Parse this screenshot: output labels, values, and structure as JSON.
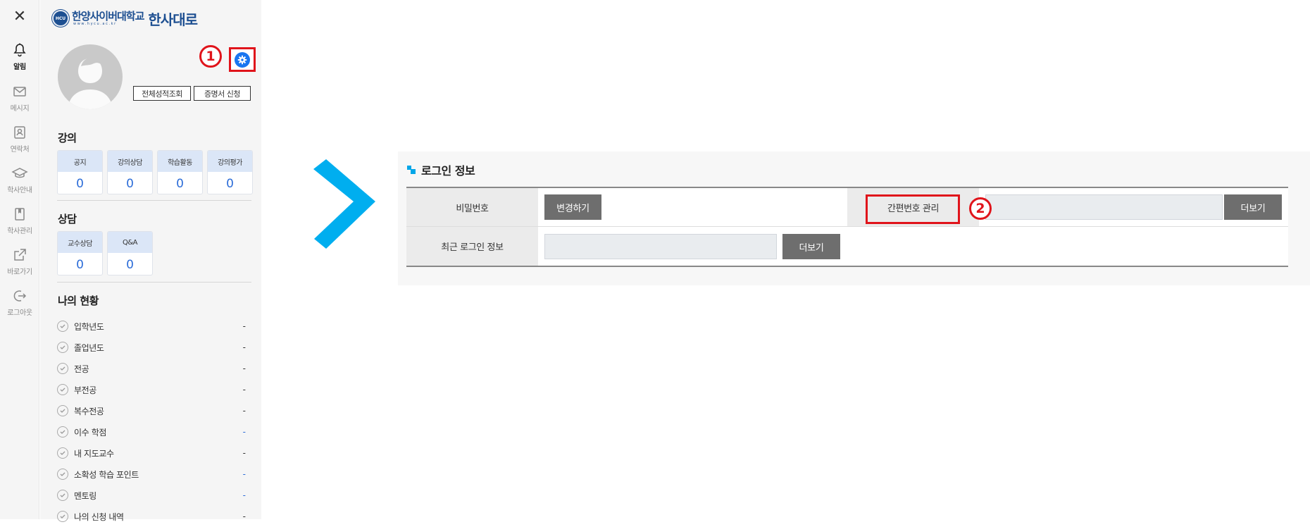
{
  "rail": {
    "close_icon": "close-icon",
    "items": [
      {
        "label": "알림",
        "icon": "bell-icon",
        "active": true
      },
      {
        "label": "메시지",
        "icon": "mail-icon"
      },
      {
        "label": "연락처",
        "icon": "contacts-icon"
      },
      {
        "label": "학사안내",
        "icon": "graduation-cap-icon"
      },
      {
        "label": "학사관리",
        "icon": "bookmark-icon"
      },
      {
        "label": "바로가기",
        "icon": "external-link-icon"
      },
      {
        "label": "로그아웃",
        "icon": "logout-icon"
      }
    ]
  },
  "panel": {
    "logo": {
      "university": "한양사이버대학교",
      "url": "www.hycu.ac.kr",
      "brand": "한사대로",
      "emblem": "HCU"
    },
    "callout_1": "1",
    "buttons": {
      "grades": "전체성적조회",
      "certificate": "증명서 신청"
    },
    "lecture": {
      "title": "강의",
      "cards": [
        {
          "label": "공지",
          "value": "0"
        },
        {
          "label": "강의상담",
          "value": "0"
        },
        {
          "label": "학습활동",
          "value": "0"
        },
        {
          "label": "강의평가",
          "value": "0"
        }
      ]
    },
    "counsel": {
      "title": "상담",
      "cards": [
        {
          "label": "교수상담",
          "value": "0"
        },
        {
          "label": "Q&A",
          "value": "0"
        }
      ]
    },
    "status": {
      "title": "나의 현황",
      "items": [
        {
          "label": "입학년도",
          "value": "-"
        },
        {
          "label": "졸업년도",
          "value": "-"
        },
        {
          "label": "전공",
          "value": "-"
        },
        {
          "label": "부전공",
          "value": "-"
        },
        {
          "label": "복수전공",
          "value": "-"
        },
        {
          "label": "이수 학점",
          "value": "-"
        },
        {
          "label": "내 지도교수",
          "value": "-"
        },
        {
          "label": "소확성 학습 포인트",
          "value": "-"
        },
        {
          "label": "멘토링",
          "value": "-"
        },
        {
          "label": "나의 신청 내역",
          "value": "-"
        }
      ]
    }
  },
  "login": {
    "title": "로그인 정보",
    "password_label": "비밀번호",
    "change_button": "변경하기",
    "pin_label": "간편번호 관리",
    "pin_more": "더보기",
    "recent_label": "최근 로그인 정보",
    "recent_more": "더보기",
    "callout_2": "2"
  },
  "colors": {
    "accent": "#00a6e8",
    "highlight": "#e0141b",
    "brand": "#1d4f91",
    "card_value": "#2b6cd8"
  }
}
